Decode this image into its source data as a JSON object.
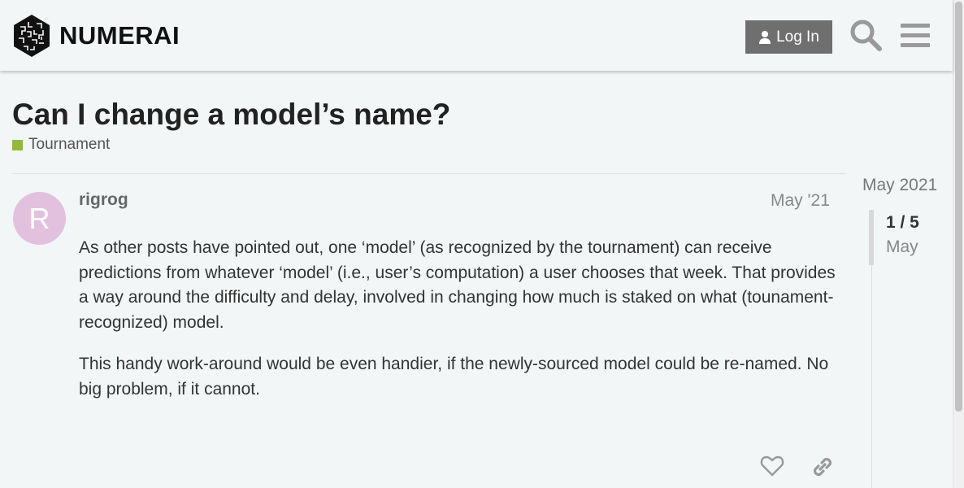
{
  "header": {
    "logo_text": "NUMERAI",
    "login_label": "Log In",
    "search_icon": "search-icon",
    "menu_icon": "hamburger-menu-icon"
  },
  "topic": {
    "title": "Can I change a model’s name?",
    "category": "Tournament",
    "category_color": "#92b93a"
  },
  "post": {
    "avatar_letter": "R",
    "avatar_color": "#e2c1df",
    "username": "rigrog",
    "date": "May '21",
    "paragraphs": [
      "As other posts have pointed out, one ‘model’ (as recognized by the tournament) can receive predictions from whatever ‘model’ (i.e., user’s computation) a user chooses that week. That provides a way around the difficulty and delay, involved in changing how much is staked on what (tounament-recognized) model.",
      "This handy work-around would be even handier, if the newly-sourced model could be re-named. No big problem, if it cannot."
    ]
  },
  "timeline": {
    "start_date": "May 2021",
    "position": "1 / 5",
    "month": "May"
  }
}
